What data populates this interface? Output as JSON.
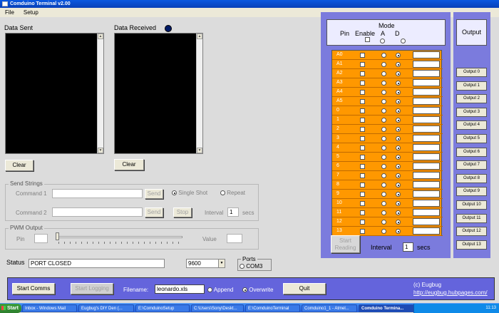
{
  "window": {
    "title": "Comduino Terminal v2.00"
  },
  "menu": [
    "File",
    "Setup"
  ],
  "data_sent": {
    "label": "Data Sent",
    "clear": "Clear"
  },
  "data_received": {
    "label": "Data Received",
    "clear": "Clear"
  },
  "send_strings": {
    "caption": "Send Strings",
    "cmd1_label": "Command 1",
    "cmd1_value": "",
    "send1": "Send",
    "single_shot": "Single Shot",
    "repeat": "Repeat",
    "cmd2_label": "Command 2",
    "cmd2_value": "",
    "send2": "Send",
    "stop": "Stop",
    "interval_label": "Interval",
    "interval_value": "1",
    "secs": "secs"
  },
  "pwm": {
    "caption": "PWM Output",
    "pin_label": "Pin",
    "pin_value": "",
    "value_label": "Value",
    "value_value": ""
  },
  "status": {
    "label": "Status",
    "value": "PORT CLOSED",
    "baud": "9600",
    "ports_label": "Ports",
    "port": "COM3"
  },
  "pins": {
    "header": {
      "pin": "Pin",
      "enable": "Enable",
      "mode": "Mode",
      "a": "A",
      "d": "D"
    },
    "rows": [
      "A0",
      "A1",
      "A2",
      "A3",
      "A4",
      "A5",
      "0",
      "1",
      "2",
      "3",
      "4",
      "5",
      "6",
      "7",
      "8",
      "9",
      "10",
      "11",
      "12",
      "13"
    ],
    "start_reading": [
      "Start",
      "Reading"
    ],
    "interval_label": "Interval",
    "interval_value": "1",
    "secs": "secs"
  },
  "outputs": {
    "header": "Output",
    "buttons": [
      "Output 0",
      "Output 1",
      "Output 2",
      "Output 3",
      "Output 4",
      "Output 5",
      "Output 6",
      "Output 7",
      "Output 8",
      "Output 9",
      "Output 10",
      "Output 11",
      "Output 12",
      "Output 13"
    ]
  },
  "bottom": {
    "start_comms": "Start Comms",
    "start_logging": "Start Logging",
    "filename_label": "Filename:",
    "filename_value": "leonardo.xls",
    "append": "Append",
    "overwrite": "Overwrite",
    "quit": "Quit",
    "copyright": "(c) Eugbug",
    "link": "http://eugbug.hubpages.com/"
  },
  "taskbar": {
    "start": "Start",
    "tasks": [
      "Inbox - Windows Mail",
      "Eugbug's DIY Den (...",
      "E:\\ComduinoSetup",
      "C:\\Users\\Sony\\Deskt...",
      "E:\\ComduinoTerminal",
      "Comduino1_1 - Atmel...",
      "Comduino Termina..."
    ],
    "clock": "11:13"
  }
}
